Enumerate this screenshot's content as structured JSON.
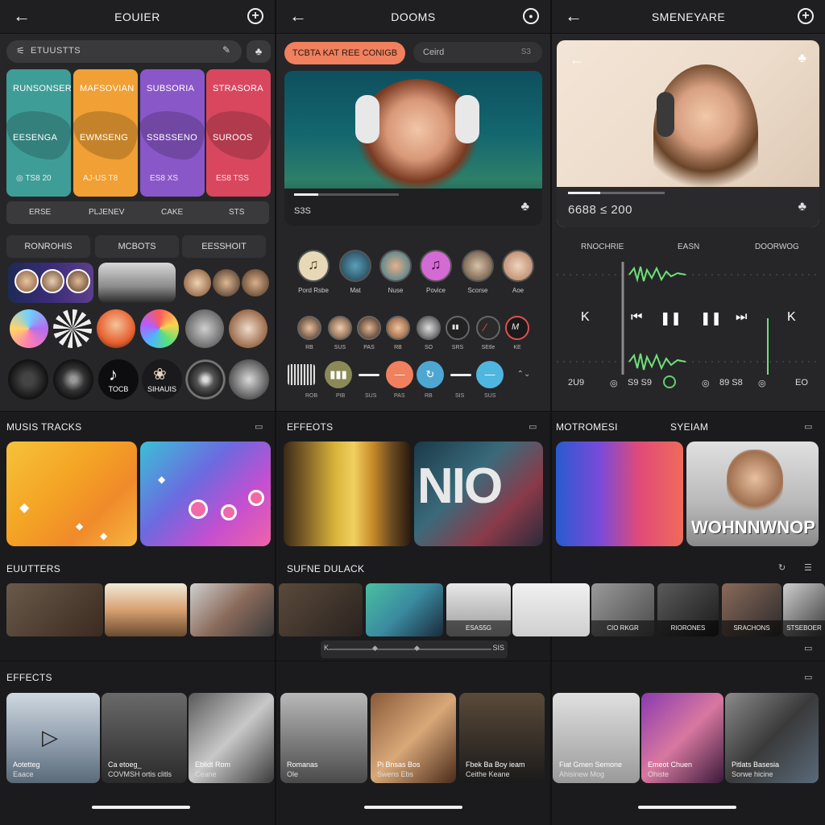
{
  "panels": [
    {
      "title": "EOUIER"
    },
    {
      "title": "DOOMS"
    },
    {
      "title": "SMENEYARE"
    }
  ],
  "panel1": {
    "search_text": "ETUUSTTS",
    "genre_cards": [
      {
        "line1": "RUNSONSER",
        "line2": "EESENGA",
        "line3": "◎ TS8  20",
        "color": "#3f9d98"
      },
      {
        "line1": "MAFSOVIAN",
        "line2": "EWMSENG",
        "line3": "AJ-US  T8",
        "color": "#f0a034"
      },
      {
        "line1": "SUBSORIA",
        "line2": "SSBSSENO",
        "line3": "ES8  XS",
        "color": "#8a57c8"
      },
      {
        "line1": "STRASORA",
        "line2": "SUROOS",
        "line3": "ES8  TSS",
        "color": "#d8475e"
      }
    ],
    "tabs": [
      "ERSE",
      "PLJENEV",
      "CAKE",
      "STS"
    ],
    "segments": [
      "RONROHIS",
      "MCBOTS",
      "EESSHOIT"
    ],
    "circle_label": "SIHAUIS",
    "music_label": "TOCB"
  },
  "panel2": {
    "pill": "TCBTA KAT REE CONIGB",
    "search_text": "Ceird",
    "search_right": "S3",
    "video_time": "S3S",
    "avatars_top": [
      "Pord Rsbe",
      "Mat",
      "Nuse",
      "Povice",
      "Scorse",
      "Aoe"
    ],
    "avatars_bottom": [
      "RB",
      "SUS",
      "PAS",
      "RB",
      "SO",
      "SRS",
      "SEtle",
      "KE"
    ],
    "player_labels": [
      "ROB",
      "PIB",
      "SUS",
      "PAS",
      "RB",
      "SIS",
      "SUS"
    ]
  },
  "panel3": {
    "video_time": "6688 ≤  200",
    "tabs": [
      "RNOCHRIE",
      "EASN",
      "DOORWOG"
    ],
    "left_val": "2U9",
    "mid_val1": "S9 S9",
    "mid_val2": "89 S8",
    "right_val": "EO"
  },
  "sections": {
    "music_tracks": "MUSIS TRACKS",
    "effects_top": "EFFEOTS",
    "motromesi": "MOTROMESI",
    "syeiam": "SYEIAM",
    "eultter": "EUUTTERS",
    "sufne": "SUFNE DULACK",
    "effects_bottom": "EFFECTS",
    "glitch_text": "WOHNNWNOP",
    "nio_text": "NIO"
  },
  "strip_captions": [
    "",
    "",
    "",
    "",
    "",
    "",
    "ESAS5G",
    "",
    "",
    "CIO RKGR",
    "RIORONES",
    "SRACHONS",
    "STSEBOER"
  ],
  "scrub_labels": [
    "K",
    "SIS"
  ],
  "bottom_cards": [
    {
      "t1": "Aotetteg",
      "t2": "Eaace"
    },
    {
      "t1": "Ca etoeg_",
      "t2": "COVMSH ortis clitls"
    },
    {
      "t1": "Eblidt Rom",
      "t2": "Ceane"
    },
    {
      "t1": "Romanas",
      "t2": "Ole"
    },
    {
      "t1": "Pi Bnsas Bos",
      "t2": "Swens Ebs"
    },
    {
      "t1": "Fbek Ba Boy ieam",
      "t2": "Ceithe Keane"
    },
    {
      "t1": "Fiat Gmen Semone",
      "t2": "Ahisinew Mog"
    },
    {
      "t1": "Emeot Chuen",
      "t2": "Ohiste"
    },
    {
      "t1": "Pitlats Basesia",
      "t2": "Sorwe hicine"
    }
  ],
  "colors": {
    "accent_orange": "#f0805e",
    "accent_teal": "#4ea7d2",
    "accent_green": "#5fd36a",
    "accent_purple": "#c96ad9"
  }
}
